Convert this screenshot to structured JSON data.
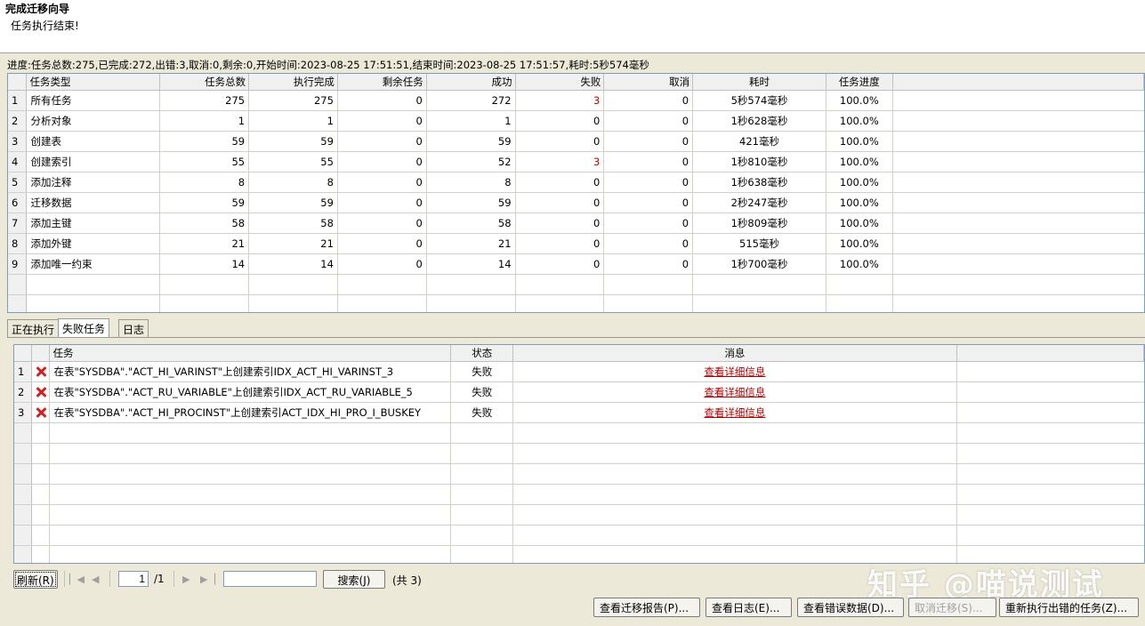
{
  "header": {
    "title": "完成迁移向导",
    "subtitle": "任务执行结束!"
  },
  "progress_text": "进度:任务总数:275,已完成:272,出错:3,取消:0,剩余:0,开始时间:2023-08-25 17:51:51,结束时间:2023-08-25 17:51:57,耗时:5秒574毫秒",
  "summary_table": {
    "columns": [
      "任务类型",
      "任务总数",
      "执行完成",
      "剩余任务",
      "成功",
      "失败",
      "取消",
      "耗时",
      "任务进度"
    ],
    "rows": [
      [
        "1",
        "所有任务",
        "275",
        "275",
        "0",
        "272",
        "3",
        "0",
        "5秒574毫秒",
        "100.0%"
      ],
      [
        "2",
        "分析对象",
        "1",
        "1",
        "0",
        "1",
        "0",
        "0",
        "1秒628毫秒",
        "100.0%"
      ],
      [
        "3",
        "创建表",
        "59",
        "59",
        "0",
        "59",
        "0",
        "0",
        "421毫秒",
        "100.0%"
      ],
      [
        "4",
        "创建索引",
        "55",
        "55",
        "0",
        "52",
        "3",
        "0",
        "1秒810毫秒",
        "100.0%"
      ],
      [
        "5",
        "添加注释",
        "8",
        "8",
        "0",
        "8",
        "0",
        "0",
        "1秒638毫秒",
        "100.0%"
      ],
      [
        "6",
        "迁移数据",
        "59",
        "59",
        "0",
        "59",
        "0",
        "0",
        "2秒247毫秒",
        "100.0%"
      ],
      [
        "7",
        "添加主键",
        "58",
        "58",
        "0",
        "58",
        "0",
        "0",
        "1秒809毫秒",
        "100.0%"
      ],
      [
        "8",
        "添加外键",
        "21",
        "21",
        "0",
        "21",
        "0",
        "0",
        "515毫秒",
        "100.0%"
      ],
      [
        "9",
        "添加唯一约束",
        "14",
        "14",
        "0",
        "14",
        "0",
        "0",
        "1秒700毫秒",
        "100.0%"
      ]
    ]
  },
  "tabs": [
    "正在执行",
    "失败任务",
    "日志"
  ],
  "active_tab": "失败任务",
  "failed_table": {
    "columns": [
      "任务",
      "状态",
      "消息"
    ],
    "rows": [
      {
        "idx": "1",
        "task": "在表\"SYSDBA\".\"ACT_HI_VARINST\"上创建索引IDX_ACT_HI_VARINST_3",
        "status": "失败",
        "message": "查看详细信息"
      },
      {
        "idx": "2",
        "task": "在表\"SYSDBA\".\"ACT_RU_VARIABLE\"上创建索引IDX_ACT_RU_VARIABLE_5",
        "status": "失败",
        "message": "查看详细信息"
      },
      {
        "idx": "3",
        "task": "在表\"SYSDBA\".\"ACT_HI_PROCINST\"上创建索引ACT_IDX_HI_PRO_I_BUSKEY",
        "status": "失败",
        "message": "查看详细信息"
      }
    ]
  },
  "pager": {
    "refresh_label": "刷新(R)",
    "page_value": "1",
    "page_total": "/1",
    "search_value": "",
    "search_label": "搜索(J)",
    "count_text": "(共 3)"
  },
  "watermark": "知乎 @喵说测试",
  "buttons": {
    "report": "查看迁移报告(P)...",
    "log": "查看日志(E)...",
    "error_data": "查看错误数据(D)...",
    "cancel_migration": "取消迁移(S)...",
    "rerun_failed": "重新执行出错的任务(Z)..."
  },
  "colors": {
    "fail_text": "#c00000",
    "link": "#b00000",
    "error_icon": "#d42020"
  }
}
